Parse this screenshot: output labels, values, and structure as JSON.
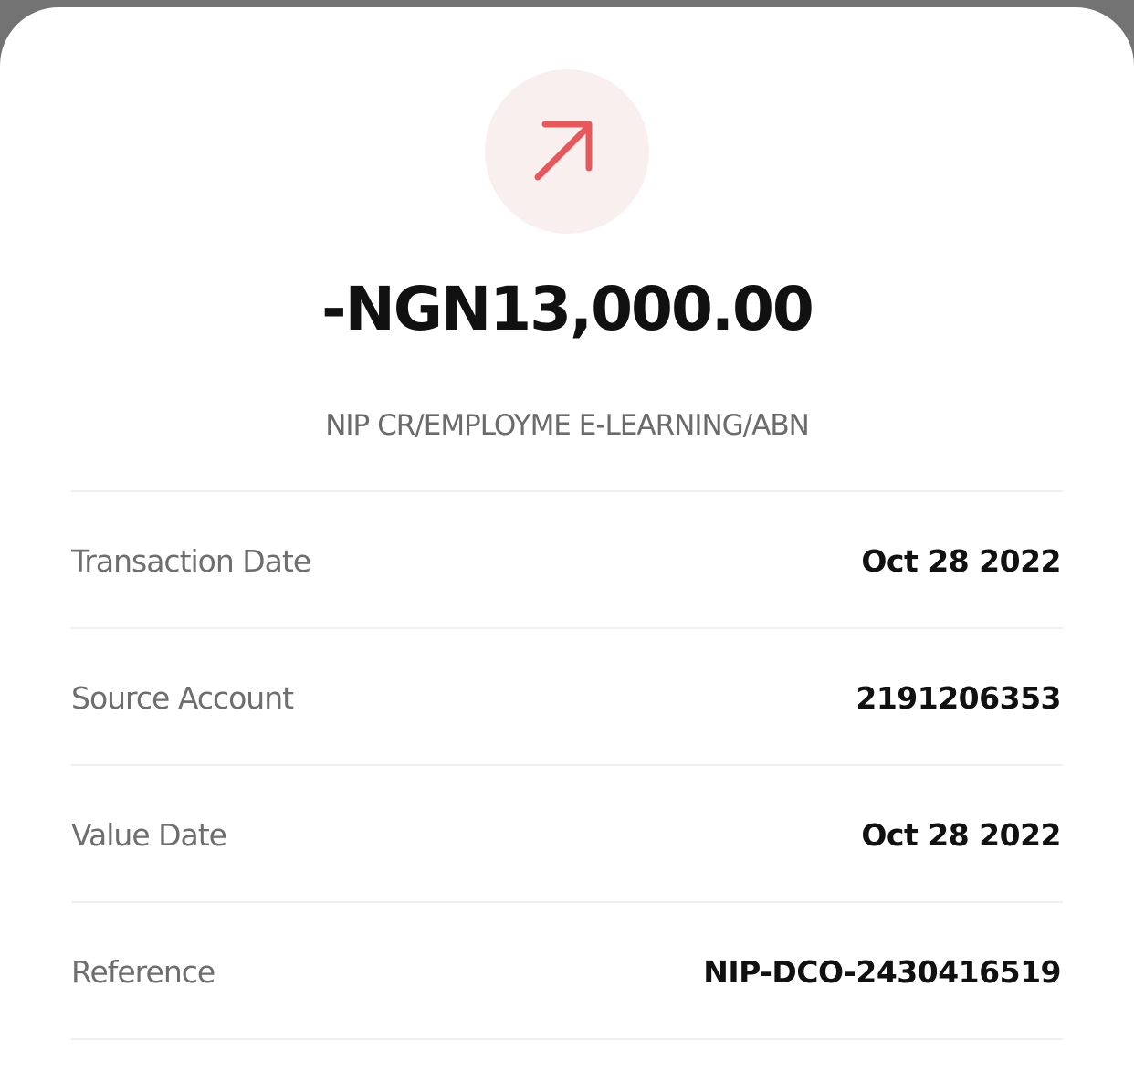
{
  "transaction": {
    "direction_icon": "arrow-up-right-icon",
    "amount": "-NGN13,000.00",
    "narration": "NIP CR/EMPLOYME E-LEARNING/ABN"
  },
  "details": [
    {
      "label": "Transaction Date",
      "value": "Oct 28 2022"
    },
    {
      "label": "Source Account",
      "value": "2191206353"
    },
    {
      "label": "Value Date",
      "value": "Oct 28 2022"
    },
    {
      "label": "Reference",
      "value": "NIP-DCO-2430416519"
    }
  ],
  "colors": {
    "debit_accent": "#e5585b",
    "icon_background": "#f9efef",
    "label_text": "#6e6e6e",
    "value_text": "#111111"
  }
}
